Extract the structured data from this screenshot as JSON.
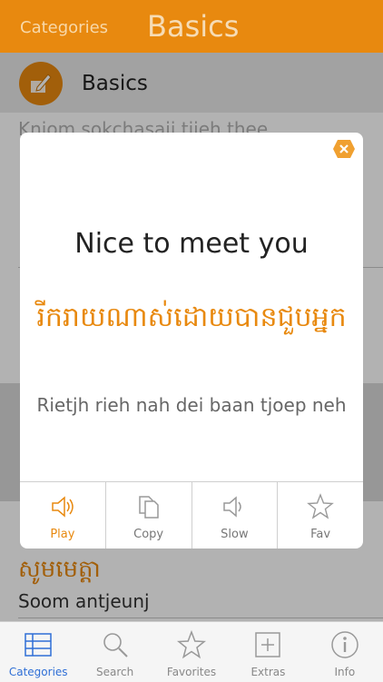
{
  "topbar": {
    "back_label": "Categories",
    "title": "Basics"
  },
  "category": {
    "name": "Basics",
    "icon": "pencil-note-icon"
  },
  "background_list": {
    "partial_text": "Kniom sokchasaii tijeh thee",
    "row_khmer": "សូមមេត្ដា",
    "row_roman": "Soom antjeunj"
  },
  "modal": {
    "english": "Nice to meet you",
    "khmer": "រីករាយណាស់ដោយបានជួបអ្នក",
    "romanization": "Rietjh rieh nah dei baan tjoep neh",
    "actions": [
      {
        "label": "Play",
        "icon": "speaker-icon",
        "active": true
      },
      {
        "label": "Copy",
        "icon": "copy-icon",
        "active": false
      },
      {
        "label": "Slow",
        "icon": "speaker-slow-icon",
        "active": false
      },
      {
        "label": "Fav",
        "icon": "star-icon",
        "active": false
      }
    ]
  },
  "tabs": [
    {
      "label": "Categories",
      "icon": "list-icon",
      "active": true
    },
    {
      "label": "Search",
      "icon": "search-icon",
      "active": false
    },
    {
      "label": "Favorites",
      "icon": "star-icon",
      "active": false
    },
    {
      "label": "Extras",
      "icon": "plus-icon",
      "active": false
    },
    {
      "label": "Info",
      "icon": "info-icon",
      "active": false
    }
  ],
  "colors": {
    "accent": "#e8890f",
    "tab_active": "#2f6fd6"
  }
}
